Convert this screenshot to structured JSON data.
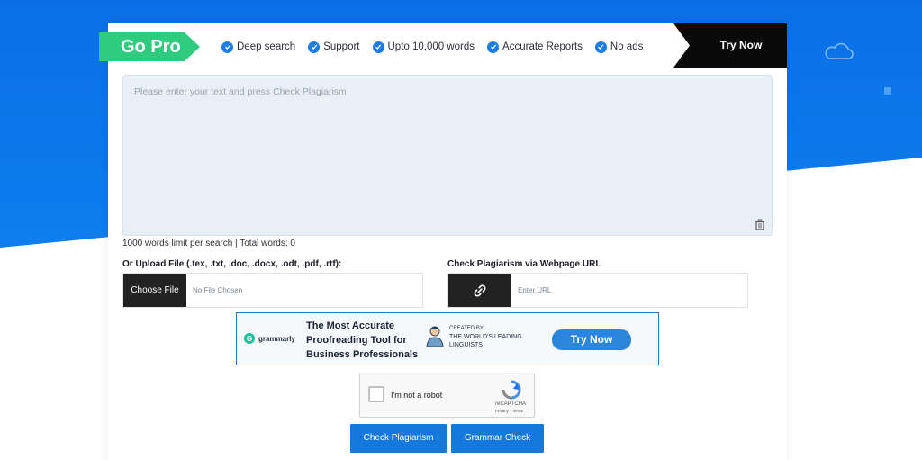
{
  "pro_banner": {
    "title": "Go Pro",
    "features": [
      {
        "label": "Deep search"
      },
      {
        "label": "Support"
      },
      {
        "label": "Upto 10,000 words"
      },
      {
        "label": "Accurate Reports"
      },
      {
        "label": "No ads"
      }
    ],
    "cta_label": "Try Now"
  },
  "textarea": {
    "placeholder": "Please enter your text and press Check Plagiarism"
  },
  "stats": {
    "word_limit_text": "1000 words limit per search | Total words: 0"
  },
  "upload": {
    "label": "Or Upload File (.tex, .txt, .doc, .docx, .odt, .pdf, .rtf):",
    "button_label": "Choose File",
    "status": "No File Chosen"
  },
  "url_check": {
    "label": "Check Plagiarism via Webpage URL",
    "placeholder": "Enter URL"
  },
  "ad": {
    "brand": "grammarly",
    "headline": "The Most Accurate Proofreading Tool for Business Professionals",
    "created_by": "CREATED BY",
    "linguists": "THE WORLD'S LEADING LINGUISTS",
    "cta": "Try Now"
  },
  "captcha": {
    "label": "I'm not a robot",
    "brand": "reCAPTCHA",
    "links": "Privacy - Terms"
  },
  "actions": {
    "check_plagiarism": "Check Plagiarism",
    "grammar_check": "Grammar Check"
  }
}
